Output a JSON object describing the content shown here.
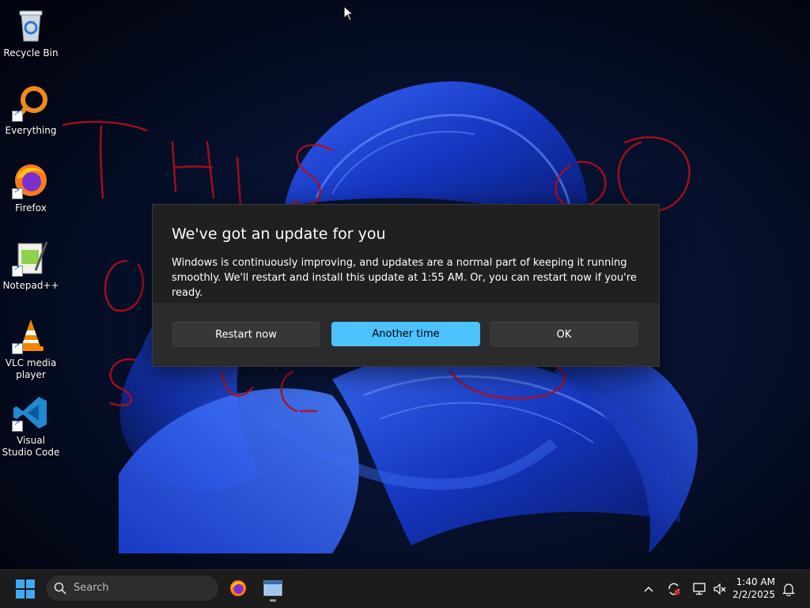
{
  "desktop": {
    "icons": [
      {
        "name": "recycle-bin",
        "label": "Recycle Bin"
      },
      {
        "name": "everything",
        "label": "Everything"
      },
      {
        "name": "firefox",
        "label": "Firefox"
      },
      {
        "name": "notepad-plus-plus",
        "label": "Notepad++"
      },
      {
        "name": "vlc",
        "label": "VLC media player"
      },
      {
        "name": "vscode",
        "label": "Visual Studio Code"
      }
    ]
  },
  "dialog": {
    "title": "We've got an update for you",
    "message": "Windows is continuously improving, and updates are a normal part of keeping it running smoothly. We'll restart and install this update at 1:55 AM. Or, you can restart now if you're ready.",
    "buttons": {
      "restart": "Restart now",
      "another": "Another time",
      "ok": "OK"
    },
    "accent_color": "#4cc2ff"
  },
  "taskbar": {
    "search_placeholder": "Search",
    "time": "1:40 AM",
    "date": "2/2/2025",
    "pinned": [
      "firefox-icon",
      "window-app-icon"
    ],
    "tray_icons": [
      "chevron-up-icon",
      "sync-icon",
      "network-icon",
      "volume-muted-icon",
      "notification-bell-icon"
    ]
  },
  "scribble_colors": {
    "ink": "#b0101a"
  }
}
